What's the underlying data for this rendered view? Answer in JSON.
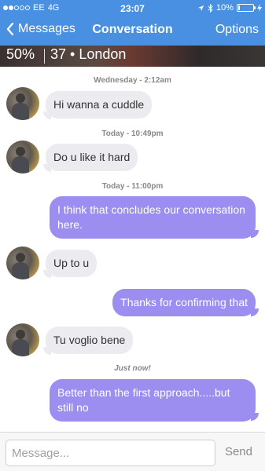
{
  "status_bar": {
    "carrier": "EE",
    "network": "4G",
    "time": "23:07",
    "battery": "10%",
    "battery_level": 0.1,
    "signal_bars_filled": 2,
    "signal_bars_total": 5
  },
  "nav": {
    "back_label": "Messages",
    "title": "Conversation",
    "options_label": "Options"
  },
  "profile": {
    "match": "50%",
    "info": "37 • London"
  },
  "timestamps": [
    "Wednesday - 2:12am",
    "Today - 10:49pm",
    "Today - 11:00pm",
    "Just now!"
  ],
  "messages": [
    {
      "direction": "in",
      "text": "Hi wanna a cuddle"
    },
    {
      "direction": "in",
      "text": "Do u like it hard"
    },
    {
      "direction": "out",
      "text": "I think that concludes our conversation here."
    },
    {
      "direction": "in",
      "text": "Up to u"
    },
    {
      "direction": "out",
      "text": "Thanks for confirming that"
    },
    {
      "direction": "in",
      "text": "Tu voglio bene"
    },
    {
      "direction": "out",
      "text": "Better than the first approach.....but still no"
    }
  ],
  "compose": {
    "placeholder": "Message...",
    "value": "",
    "send_label": "Send"
  },
  "colors": {
    "header": "#4a90e2",
    "outgoing_bubble": "#9b8ef0",
    "incoming_bubble": "#ebebf0"
  }
}
